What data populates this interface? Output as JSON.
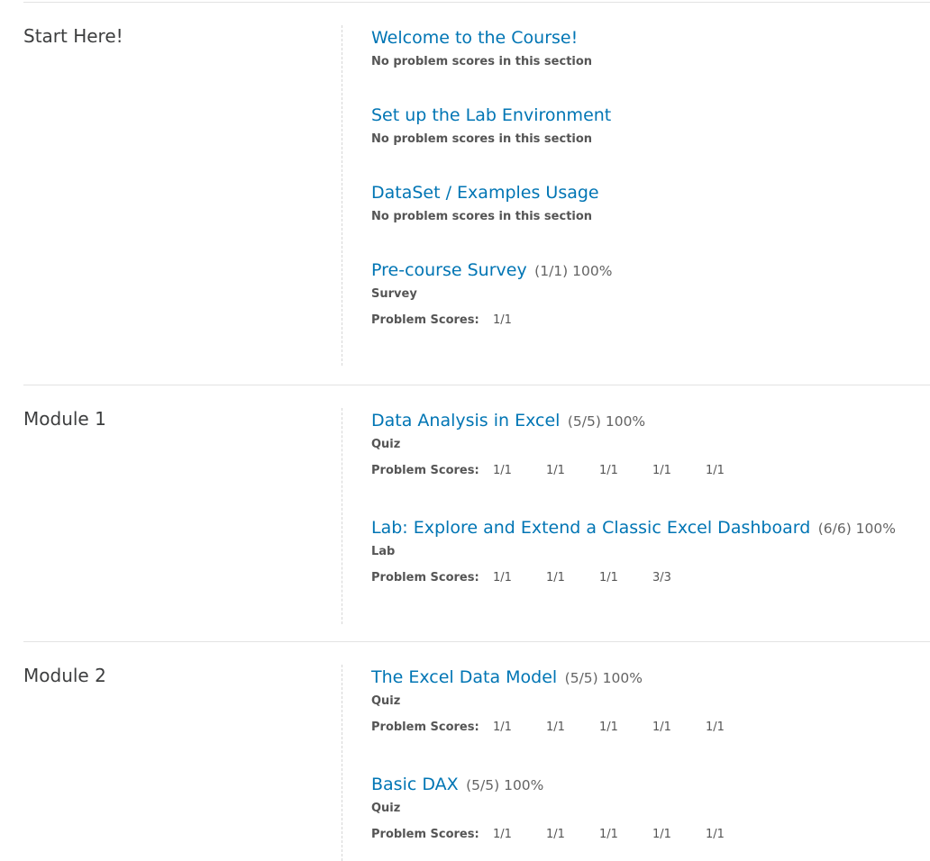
{
  "labels": {
    "no_scores": "No problem scores in this section",
    "problem_scores": "Problem Scores:"
  },
  "chapters": [
    {
      "title": "Start Here!",
      "sections": [
        {
          "title": "Welcome to the Course!"
        },
        {
          "title": "Set up the Lab Environment"
        },
        {
          "title": "DataSet / Examples Usage"
        },
        {
          "title": "Pre-course Survey",
          "score": "(1/1) 100%",
          "type": "Survey",
          "scores": [
            "1/1"
          ]
        }
      ]
    },
    {
      "title": "Module 1",
      "sections": [
        {
          "title": "Data Analysis in Excel",
          "score": "(5/5) 100%",
          "type": "Quiz",
          "scores": [
            "1/1",
            "1/1",
            "1/1",
            "1/1",
            "1/1"
          ]
        },
        {
          "title": "Lab: Explore and Extend a Classic Excel Dashboard",
          "score": "(6/6) 100%",
          "type": "Lab",
          "scores": [
            "1/1",
            "1/1",
            "1/1",
            "3/3"
          ]
        }
      ]
    },
    {
      "title": "Module 2",
      "sections": [
        {
          "title": "The Excel Data Model",
          "score": "(5/5) 100%",
          "type": "Quiz",
          "scores": [
            "1/1",
            "1/1",
            "1/1",
            "1/1",
            "1/1"
          ]
        },
        {
          "title": "Basic DAX",
          "score": "(5/5) 100%",
          "type": "Quiz",
          "scores": [
            "1/1",
            "1/1",
            "1/1",
            "1/1",
            "1/1"
          ]
        }
      ]
    }
  ],
  "colors": {
    "link": "#0075b4",
    "text": "#313131",
    "muted": "#646464",
    "rule": "#e3e3e3"
  }
}
